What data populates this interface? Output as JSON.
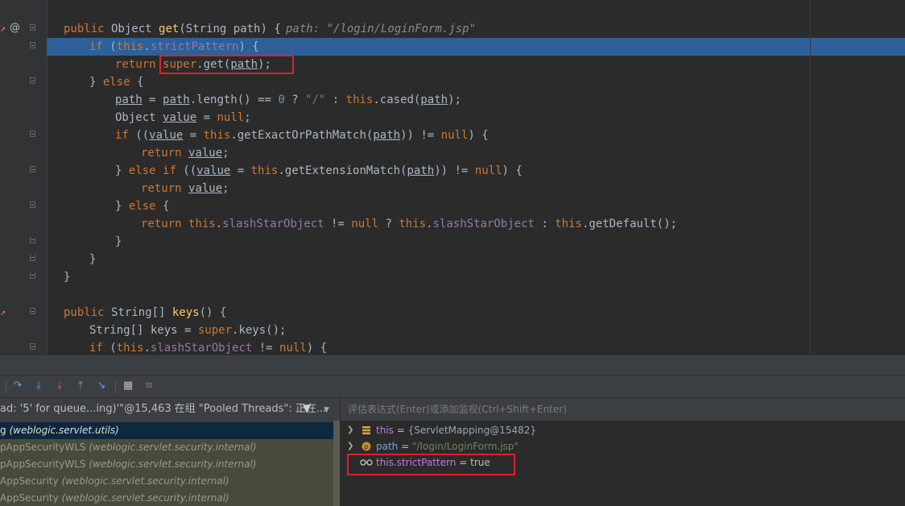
{
  "editor": {
    "hint": "path: \"/login/LoginForm.jsp\"",
    "lines": [
      {
        "code": "public Object get(String path) {"
      },
      {
        "code": "if (this.strictPattern) {"
      },
      {
        "code": "return super.get(path);"
      },
      {
        "code": "} else {"
      },
      {
        "code": "path = path.length() == 0 ? \"/\" : this.cased(path);"
      },
      {
        "code": "Object value = null;"
      },
      {
        "code": "if ((value = this.getExactOrPathMatch(path)) != null) {"
      },
      {
        "code": "return value;"
      },
      {
        "code": "} else if ((value = this.getExtensionMatch(path)) != null) {"
      },
      {
        "code": "return value;"
      },
      {
        "code": "} else {"
      },
      {
        "code": "return this.slashStarObject != null ? this.slashStarObject : this.getDefault();"
      },
      {
        "code": "}"
      },
      {
        "code": "}"
      },
      {
        "code": "}"
      },
      {
        "code": ""
      },
      {
        "code": "public String[] keys() {"
      },
      {
        "code": "String[] keys = super.keys();"
      },
      {
        "code": "if (this.slashStarObject != null) {"
      }
    ]
  },
  "debugger": {
    "toolbar": [
      "show-execution-point",
      "step-over",
      "step-into",
      "force-step-into",
      "step-out",
      "run-to-cursor",
      "evaluate-expression",
      "trace-current-stream-chain"
    ],
    "thread": "ad: '5' for queue...ing)'\"@15,463 在组 \"Pooled Threads\": 正在...",
    "frames": [
      {
        "method": "g",
        "package": "(weblogic.servlet.utils)"
      },
      {
        "method": "pAppSecurityWLS",
        "package": "(weblogic.servlet.security.internal)"
      },
      {
        "method": "pAppSecurityWLS",
        "package": "(weblogic.servlet.security.internal)"
      },
      {
        "method": "AppSecurity",
        "package": "(weblogic.servlet.security.internal)"
      },
      {
        "method": "AppSecurity",
        "package": "(weblogic.servlet.security.internal)"
      }
    ],
    "watch_placeholder": "评估表达式(Enter)或添加监视(Ctrl+Shift+Enter)",
    "variables": [
      {
        "name": "this",
        "eq": " = ",
        "value": "{ServletMapping@15482}"
      },
      {
        "name": "path",
        "eq": " = ",
        "value": "\"/login/LoginForm.jsp\""
      },
      {
        "name": "this.strictPattern",
        "eq": " = ",
        "value": "true"
      }
    ]
  },
  "colors": {
    "keyword": "#cc7832",
    "method": "#ffc66d",
    "field": "#9876aa",
    "string": "#6a8759",
    "number": "#6897bb",
    "highlight": "#2d6099",
    "box": "#e0202a"
  }
}
